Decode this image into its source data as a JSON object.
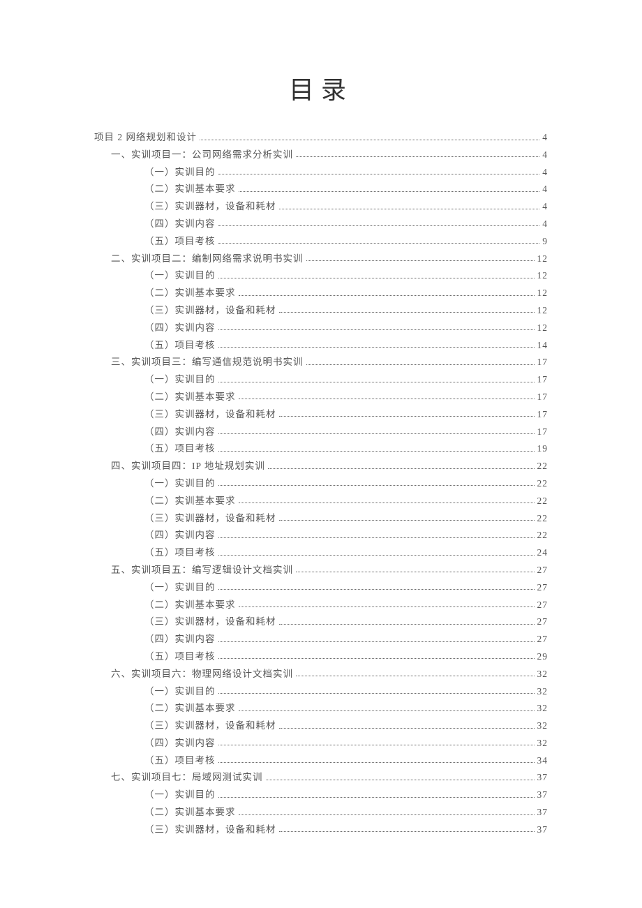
{
  "title": "目录",
  "toc": [
    {
      "level": 0,
      "label": "项目 2 网络规划和设计",
      "page": "4"
    },
    {
      "level": 1,
      "label": "一、实训项目一：公司网络需求分析实训",
      "page": "4"
    },
    {
      "level": 2,
      "label": "（一）实训目的",
      "page": "4"
    },
    {
      "level": 2,
      "label": "（二）实训基本要求",
      "page": "4"
    },
    {
      "level": 2,
      "label": "（三）实训器材，设备和耗材",
      "page": "4"
    },
    {
      "level": 2,
      "label": "（四）实训内容",
      "page": "4"
    },
    {
      "level": 2,
      "label": "（五）项目考核",
      "page": "9"
    },
    {
      "level": 1,
      "label": "二、实训项目二：编制网络需求说明书实训",
      "page": "12"
    },
    {
      "level": 2,
      "label": "（一）实训目的",
      "page": "12"
    },
    {
      "level": 2,
      "label": "（二）实训基本要求",
      "page": "12"
    },
    {
      "level": 2,
      "label": "（三）实训器材，设备和耗材",
      "page": "12"
    },
    {
      "level": 2,
      "label": "（四）实训内容",
      "page": "12"
    },
    {
      "level": 2,
      "label": "（五）项目考核",
      "page": "14"
    },
    {
      "level": 1,
      "label": "三、实训项目三：编写通信规范说明书实训",
      "page": "17"
    },
    {
      "level": 2,
      "label": "（一）实训目的",
      "page": "17"
    },
    {
      "level": 2,
      "label": "（二）实训基本要求",
      "page": "17"
    },
    {
      "level": 2,
      "label": "（三）实训器材，设备和耗材",
      "page": "17"
    },
    {
      "level": 2,
      "label": "（四）实训内容",
      "page": "17"
    },
    {
      "level": 2,
      "label": "（五）项目考核",
      "page": "19"
    },
    {
      "level": 1,
      "label": "四、实训项目四：IP 地址规划实训",
      "page": "22"
    },
    {
      "level": 2,
      "label": "（一）实训目的",
      "page": "22"
    },
    {
      "level": 2,
      "label": "（二）实训基本要求",
      "page": "22"
    },
    {
      "level": 2,
      "label": "（三）实训器材，设备和耗材",
      "page": "22"
    },
    {
      "level": 2,
      "label": "（四）实训内容",
      "page": "22"
    },
    {
      "level": 2,
      "label": "（五）项目考核",
      "page": "24"
    },
    {
      "level": 1,
      "label": "五、实训项目五：编写逻辑设计文档实训",
      "page": "27"
    },
    {
      "level": 2,
      "label": "（一）实训目的",
      "page": "27"
    },
    {
      "level": 2,
      "label": "（二）实训基本要求",
      "page": "27"
    },
    {
      "level": 2,
      "label": "（三）实训器材，设备和耗材",
      "page": "27"
    },
    {
      "level": 2,
      "label": "（四）实训内容",
      "page": "27"
    },
    {
      "level": 2,
      "label": "（五）项目考核",
      "page": "29"
    },
    {
      "level": 1,
      "label": "六、实训项目六：物理网络设计文档实训",
      "page": "32"
    },
    {
      "level": 2,
      "label": "（一）实训目的",
      "page": "32"
    },
    {
      "level": 2,
      "label": "（二）实训基本要求",
      "page": "32"
    },
    {
      "level": 2,
      "label": "（三）实训器材，设备和耗材",
      "page": "32"
    },
    {
      "level": 2,
      "label": "（四）实训内容",
      "page": "32"
    },
    {
      "level": 2,
      "label": "（五）项目考核",
      "page": "34"
    },
    {
      "level": 1,
      "label": "七、实训项目七：局域网测试实训",
      "page": "37"
    },
    {
      "level": 2,
      "label": "（一）实训目的",
      "page": "37"
    },
    {
      "level": 2,
      "label": "（二）实训基本要求",
      "page": "37"
    },
    {
      "level": 2,
      "label": "（三）实训器材，设备和耗材",
      "page": "37"
    }
  ]
}
